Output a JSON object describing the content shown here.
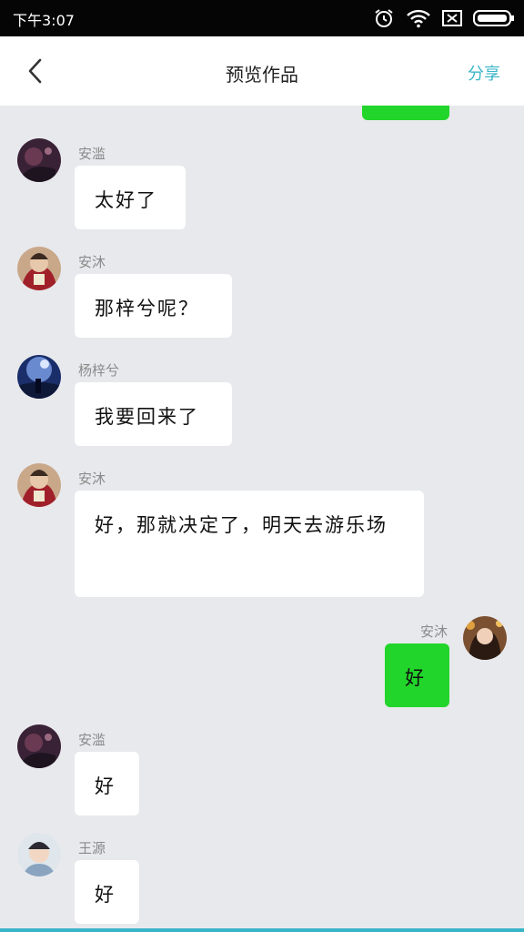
{
  "status_bar": {
    "time": "下午3:07",
    "icons": [
      "alarm-icon",
      "wifi-icon",
      "sim-card-icon",
      "battery-icon"
    ]
  },
  "header": {
    "title": "预览作品",
    "share_label": "分享",
    "back_icon": "chevron-left-icon"
  },
  "colors": {
    "accent": "#3ab5c8",
    "self_bubble": "#22d52a",
    "background": "#e8e9ed"
  },
  "messages": [
    {
      "side": "left",
      "name": "安滥",
      "text": "太好了"
    },
    {
      "side": "left",
      "name": "安沐",
      "text": "那梓兮呢？"
    },
    {
      "side": "left",
      "name": "杨梓兮",
      "text": "我要回来了"
    },
    {
      "side": "left",
      "name": "安沐",
      "text": "好，那就决定了，明天去游乐场"
    },
    {
      "side": "right",
      "name": "安沐",
      "text": "好"
    },
    {
      "side": "left",
      "name": "安滥",
      "text": "好"
    },
    {
      "side": "left",
      "name": "王源",
      "text": "好"
    }
  ]
}
